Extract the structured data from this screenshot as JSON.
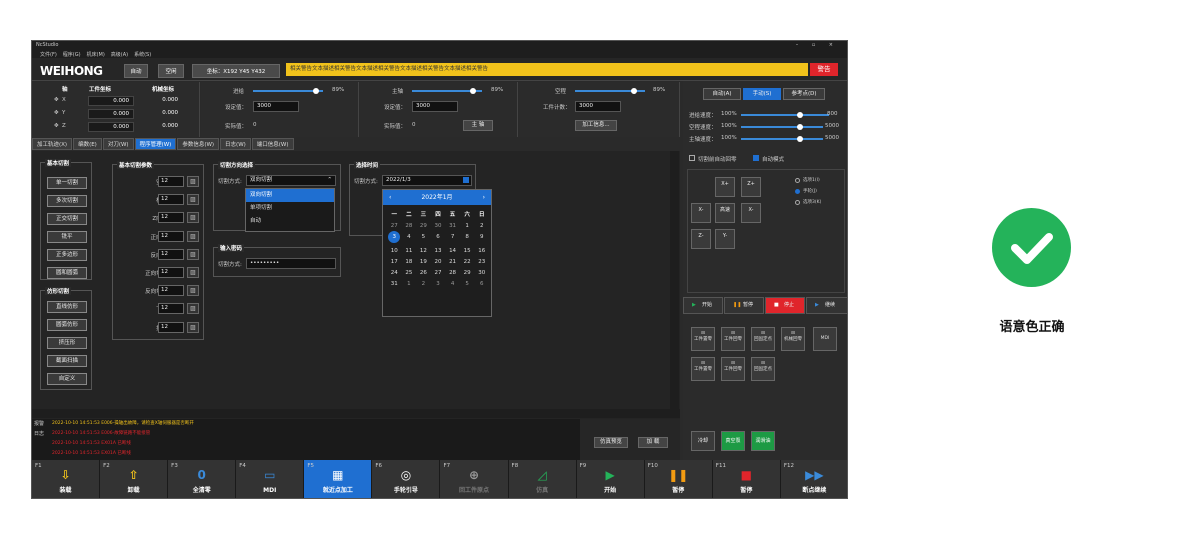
{
  "app": {
    "title": "NcStudio",
    "window_controls": "– ▫ ×"
  },
  "menu": [
    "文件(F)",
    "程序(G)",
    "机床(M)",
    "高级(A)",
    "系统(S)"
  ],
  "header": {
    "logo": "WEIHONG",
    "mode_auto": "自动",
    "mode_idle": "空闲",
    "coords": "坐标：X192   Y45   Y432",
    "warning_text": "相关警告文本描述相关警告文本描述相关警告文本描述相关警告文本描述相关警告",
    "warning_button": "警告"
  },
  "coords": {
    "axis_header": "轴",
    "work_header": "工件坐标",
    "machine_header": "机械坐标",
    "rows": [
      {
        "axis": "X",
        "work": "0.000",
        "machine": "0.000"
      },
      {
        "axis": "Y",
        "work": "0.000",
        "machine": "0.000"
      },
      {
        "axis": "Z",
        "work": "0.000",
        "machine": "0.000"
      }
    ]
  },
  "feed": {
    "label": "进给",
    "pct": "89%",
    "set_label": "设定值：",
    "set_value": "3000",
    "actual_label": "实际值：",
    "actual_value": "0"
  },
  "spindle": {
    "label": "主轴",
    "pct": "89%",
    "set_label": "设定值：",
    "set_value": "3000",
    "actual_label": "实际值：",
    "actual_value": "0",
    "button": "主 轴"
  },
  "travel": {
    "label": "空程",
    "pct": "89%",
    "count_label": "工件计数：",
    "count_value": "3000",
    "button": "加工信息..."
  },
  "tabs": [
    "加工轨迹(X)",
    "编数(E)",
    "对刀(W)",
    "程序管理(W)",
    "参数信息(W)",
    "日志(W)",
    "端口信息(W)"
  ],
  "basic_cut": {
    "title": "基本切割",
    "buttons": [
      "单一切割",
      "多次切割",
      "正交切割",
      "铣平",
      "正多边形",
      "圆和圆弧"
    ]
  },
  "shape_cut": {
    "title": "仿形切割",
    "buttons": [
      "直线仿形",
      "圆弧仿形",
      "挤压形",
      "截面扫描",
      "自定义"
    ]
  },
  "params": {
    "title": "基本切割参数",
    "rows": [
      {
        "label": "安全高度:",
        "value": "12"
      },
      {
        "label": "板材厚度:",
        "value": "12"
      },
      {
        "label": "Z向过切量:",
        "value": "12"
      },
      {
        "label": "正向切割量:",
        "value": "12"
      },
      {
        "label": "反向切割量:",
        "value": "12"
      },
      {
        "label": "正向切割速度:",
        "value": "12"
      },
      {
        "label": "反向切割速度:",
        "value": "12"
      },
      {
        "label": "下刀速度:",
        "value": "12"
      },
      {
        "label": "提刀速度:",
        "value": "12"
      }
    ]
  },
  "direction": {
    "title": "切割方向选择",
    "label": "切割方式:",
    "value": "双向切割",
    "options": [
      "双向切割",
      "单项切割",
      "自动"
    ]
  },
  "password": {
    "title": "输入密码",
    "label": "切割方式:",
    "value": "•••••••••"
  },
  "time": {
    "title": "选择时间",
    "label": "切割方式:",
    "value": "2022/1/3",
    "month": "2022年1月",
    "weekdays": [
      "一",
      "二",
      "三",
      "四",
      "五",
      "六",
      "日"
    ],
    "days": [
      "27",
      "28",
      "29",
      "30",
      "31",
      "1",
      "2",
      "3",
      "4",
      "5",
      "6",
      "7",
      "8",
      "9",
      "10",
      "11",
      "12",
      "13",
      "14",
      "15",
      "16",
      "17",
      "18",
      "19",
      "20",
      "21",
      "22",
      "23",
      "24",
      "25",
      "26",
      "27",
      "28",
      "29",
      "30",
      "31",
      "1",
      "2",
      "3",
      "4",
      "5",
      "6"
    ]
  },
  "log": {
    "tags": [
      "报警",
      "日志"
    ],
    "rows": [
      "2022-10-10 14:51:53  E006-操轴出故障，请检查X轴伺服器是否断开",
      "2022-10-10 14:51:53  E006-故障链路不能接管",
      "2022-10-10 14:51:53  EX01A 已断线",
      "2022-10-10 14:51:53  EX01A 已断线"
    ]
  },
  "sim": {
    "preview": "仿真预览",
    "load": "加 载"
  },
  "right": {
    "modes": [
      "自动(A)",
      "手动(S)",
      "参考点(D)"
    ],
    "speeds": [
      {
        "label": "进给速度：",
        "pct": "100%",
        "value": "800"
      },
      {
        "label": "空程速度：",
        "pct": "100%",
        "value": "5000"
      },
      {
        "label": "主轴速度：",
        "pct": "100%",
        "value": "5000"
      }
    ],
    "check1": "切割前自动回零",
    "check2": "自动模式",
    "jog": {
      "xplus": "X+",
      "yplus": "Y+",
      "zplus": "Z+",
      "xminus": "X-",
      "fast": "高速",
      "yminus": "Y-",
      "zminus": "Z-",
      "xminus2": "X-"
    },
    "radios": [
      "选项1(I)",
      "手轮(J)",
      "选项3(K)"
    ],
    "ctl": [
      "开始",
      "暂停",
      "停止",
      "继续"
    ],
    "tools": [
      "工件置零",
      "工件回零",
      "回固定点",
      "机械回零",
      "MDI",
      "工件置零",
      "工件回零",
      "回固定点"
    ],
    "bottom": [
      "冷却",
      "真空泵",
      "润滑油"
    ]
  },
  "fkeys": [
    {
      "num": "F1",
      "label": "装载"
    },
    {
      "num": "F2",
      "label": "卸载"
    },
    {
      "num": "F3",
      "label": "全清零"
    },
    {
      "num": "F4",
      "label": "MDI"
    },
    {
      "num": "F5",
      "label": "就近点加工"
    },
    {
      "num": "F6",
      "label": "手轮引导"
    },
    {
      "num": "F7",
      "label": "回工件原点"
    },
    {
      "num": "F8",
      "label": "仿真"
    },
    {
      "num": "F9",
      "label": "开始"
    },
    {
      "num": "F10",
      "label": "暂停"
    },
    {
      "num": "F11",
      "label": "暂停"
    },
    {
      "num": "F12",
      "label": "断点继续"
    }
  ],
  "caption": "语意色正确",
  "colors": {
    "accent": "#1f6fd1",
    "warning": "#f1c21b",
    "danger": "#e0252b",
    "success": "#24b35a"
  }
}
